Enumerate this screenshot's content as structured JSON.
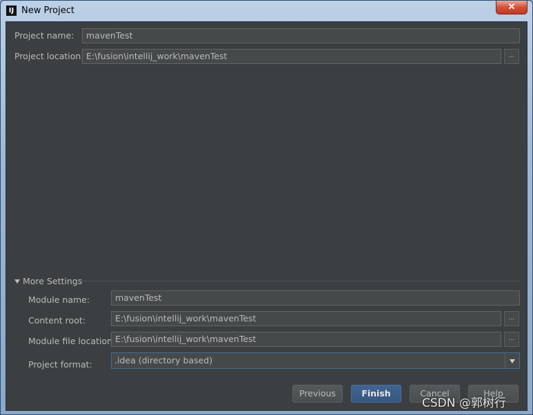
{
  "window": {
    "title": "New Project",
    "close_glyph": "✕",
    "app_icon_text": "IJ"
  },
  "project": {
    "name_label": "Project name:",
    "name_value": "mavenTest",
    "location_label": "Project location:",
    "location_value": "E:\\fusion\\intellij_work\\mavenTest",
    "browse_glyph": "..."
  },
  "more_settings": {
    "title": "More Settings",
    "module_name_label": "Module name:",
    "module_name_value": "mavenTest",
    "content_root_label": "Content root:",
    "content_root_value": "E:\\fusion\\intellij_work\\mavenTest",
    "module_file_location_label": "Module file location:",
    "module_file_location_value": "E:\\fusion\\intellij_work\\mavenTest",
    "project_format_label": "Project format:",
    "project_format_value": ".idea (directory based)"
  },
  "buttons": {
    "previous": "Previous",
    "finish": "Finish",
    "cancel": "Cancel",
    "help": "Help"
  },
  "watermark": "CSDN @郭树行",
  "colors": {
    "panel_bg": "#3c3f41",
    "field_bg": "#45494a",
    "text": "#bbbbbb",
    "primary_button": "#365880"
  }
}
